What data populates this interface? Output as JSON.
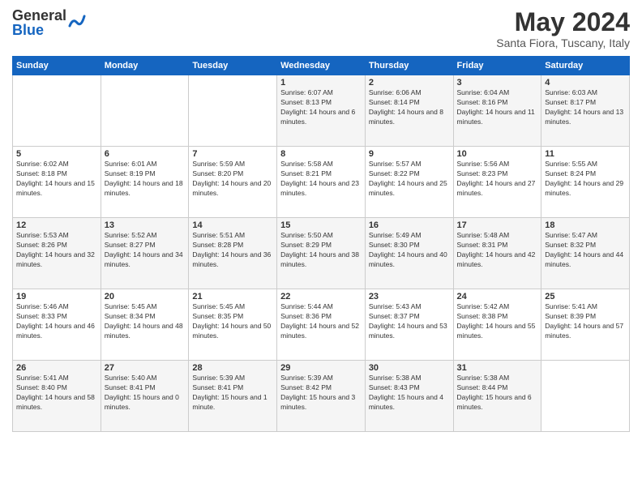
{
  "header": {
    "logo_general": "General",
    "logo_blue": "Blue",
    "month_year": "May 2024",
    "location": "Santa Fiora, Tuscany, Italy"
  },
  "weekdays": [
    "Sunday",
    "Monday",
    "Tuesday",
    "Wednesday",
    "Thursday",
    "Friday",
    "Saturday"
  ],
  "weeks": [
    [
      {
        "day": "",
        "sunrise": "",
        "sunset": "",
        "daylight": ""
      },
      {
        "day": "",
        "sunrise": "",
        "sunset": "",
        "daylight": ""
      },
      {
        "day": "",
        "sunrise": "",
        "sunset": "",
        "daylight": ""
      },
      {
        "day": "1",
        "sunrise": "Sunrise: 6:07 AM",
        "sunset": "Sunset: 8:13 PM",
        "daylight": "Daylight: 14 hours and 6 minutes."
      },
      {
        "day": "2",
        "sunrise": "Sunrise: 6:06 AM",
        "sunset": "Sunset: 8:14 PM",
        "daylight": "Daylight: 14 hours and 8 minutes."
      },
      {
        "day": "3",
        "sunrise": "Sunrise: 6:04 AM",
        "sunset": "Sunset: 8:16 PM",
        "daylight": "Daylight: 14 hours and 11 minutes."
      },
      {
        "day": "4",
        "sunrise": "Sunrise: 6:03 AM",
        "sunset": "Sunset: 8:17 PM",
        "daylight": "Daylight: 14 hours and 13 minutes."
      }
    ],
    [
      {
        "day": "5",
        "sunrise": "Sunrise: 6:02 AM",
        "sunset": "Sunset: 8:18 PM",
        "daylight": "Daylight: 14 hours and 15 minutes."
      },
      {
        "day": "6",
        "sunrise": "Sunrise: 6:01 AM",
        "sunset": "Sunset: 8:19 PM",
        "daylight": "Daylight: 14 hours and 18 minutes."
      },
      {
        "day": "7",
        "sunrise": "Sunrise: 5:59 AM",
        "sunset": "Sunset: 8:20 PM",
        "daylight": "Daylight: 14 hours and 20 minutes."
      },
      {
        "day": "8",
        "sunrise": "Sunrise: 5:58 AM",
        "sunset": "Sunset: 8:21 PM",
        "daylight": "Daylight: 14 hours and 23 minutes."
      },
      {
        "day": "9",
        "sunrise": "Sunrise: 5:57 AM",
        "sunset": "Sunset: 8:22 PM",
        "daylight": "Daylight: 14 hours and 25 minutes."
      },
      {
        "day": "10",
        "sunrise": "Sunrise: 5:56 AM",
        "sunset": "Sunset: 8:23 PM",
        "daylight": "Daylight: 14 hours and 27 minutes."
      },
      {
        "day": "11",
        "sunrise": "Sunrise: 5:55 AM",
        "sunset": "Sunset: 8:24 PM",
        "daylight": "Daylight: 14 hours and 29 minutes."
      }
    ],
    [
      {
        "day": "12",
        "sunrise": "Sunrise: 5:53 AM",
        "sunset": "Sunset: 8:26 PM",
        "daylight": "Daylight: 14 hours and 32 minutes."
      },
      {
        "day": "13",
        "sunrise": "Sunrise: 5:52 AM",
        "sunset": "Sunset: 8:27 PM",
        "daylight": "Daylight: 14 hours and 34 minutes."
      },
      {
        "day": "14",
        "sunrise": "Sunrise: 5:51 AM",
        "sunset": "Sunset: 8:28 PM",
        "daylight": "Daylight: 14 hours and 36 minutes."
      },
      {
        "day": "15",
        "sunrise": "Sunrise: 5:50 AM",
        "sunset": "Sunset: 8:29 PM",
        "daylight": "Daylight: 14 hours and 38 minutes."
      },
      {
        "day": "16",
        "sunrise": "Sunrise: 5:49 AM",
        "sunset": "Sunset: 8:30 PM",
        "daylight": "Daylight: 14 hours and 40 minutes."
      },
      {
        "day": "17",
        "sunrise": "Sunrise: 5:48 AM",
        "sunset": "Sunset: 8:31 PM",
        "daylight": "Daylight: 14 hours and 42 minutes."
      },
      {
        "day": "18",
        "sunrise": "Sunrise: 5:47 AM",
        "sunset": "Sunset: 8:32 PM",
        "daylight": "Daylight: 14 hours and 44 minutes."
      }
    ],
    [
      {
        "day": "19",
        "sunrise": "Sunrise: 5:46 AM",
        "sunset": "Sunset: 8:33 PM",
        "daylight": "Daylight: 14 hours and 46 minutes."
      },
      {
        "day": "20",
        "sunrise": "Sunrise: 5:45 AM",
        "sunset": "Sunset: 8:34 PM",
        "daylight": "Daylight: 14 hours and 48 minutes."
      },
      {
        "day": "21",
        "sunrise": "Sunrise: 5:45 AM",
        "sunset": "Sunset: 8:35 PM",
        "daylight": "Daylight: 14 hours and 50 minutes."
      },
      {
        "day": "22",
        "sunrise": "Sunrise: 5:44 AM",
        "sunset": "Sunset: 8:36 PM",
        "daylight": "Daylight: 14 hours and 52 minutes."
      },
      {
        "day": "23",
        "sunrise": "Sunrise: 5:43 AM",
        "sunset": "Sunset: 8:37 PM",
        "daylight": "Daylight: 14 hours and 53 minutes."
      },
      {
        "day": "24",
        "sunrise": "Sunrise: 5:42 AM",
        "sunset": "Sunset: 8:38 PM",
        "daylight": "Daylight: 14 hours and 55 minutes."
      },
      {
        "day": "25",
        "sunrise": "Sunrise: 5:41 AM",
        "sunset": "Sunset: 8:39 PM",
        "daylight": "Daylight: 14 hours and 57 minutes."
      }
    ],
    [
      {
        "day": "26",
        "sunrise": "Sunrise: 5:41 AM",
        "sunset": "Sunset: 8:40 PM",
        "daylight": "Daylight: 14 hours and 58 minutes."
      },
      {
        "day": "27",
        "sunrise": "Sunrise: 5:40 AM",
        "sunset": "Sunset: 8:41 PM",
        "daylight": "Daylight: 15 hours and 0 minutes."
      },
      {
        "day": "28",
        "sunrise": "Sunrise: 5:39 AM",
        "sunset": "Sunset: 8:41 PM",
        "daylight": "Daylight: 15 hours and 1 minute."
      },
      {
        "day": "29",
        "sunrise": "Sunrise: 5:39 AM",
        "sunset": "Sunset: 8:42 PM",
        "daylight": "Daylight: 15 hours and 3 minutes."
      },
      {
        "day": "30",
        "sunrise": "Sunrise: 5:38 AM",
        "sunset": "Sunset: 8:43 PM",
        "daylight": "Daylight: 15 hours and 4 minutes."
      },
      {
        "day": "31",
        "sunrise": "Sunrise: 5:38 AM",
        "sunset": "Sunset: 8:44 PM",
        "daylight": "Daylight: 15 hours and 6 minutes."
      },
      {
        "day": "",
        "sunrise": "",
        "sunset": "",
        "daylight": ""
      }
    ]
  ]
}
